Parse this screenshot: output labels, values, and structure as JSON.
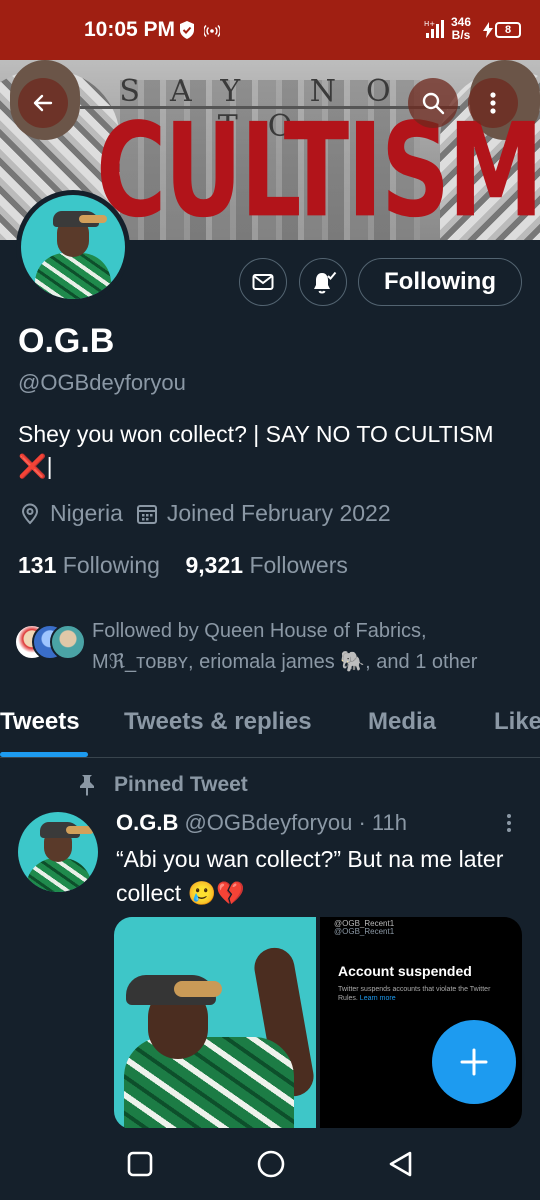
{
  "status_bar": {
    "time": "10:05 PM",
    "network_speed_value": "346",
    "network_speed_unit": "B/s",
    "battery": "8"
  },
  "header": {
    "banner_text_top": "SAY NO TO",
    "banner_text_main": "CULTISM",
    "back_icon": "arrow-left-icon",
    "search_icon": "search-icon",
    "more_icon": "more-vertical-icon"
  },
  "profile": {
    "display_name": "O.G.B",
    "handle": "@OGBdeyforyou",
    "bio": "Shey you won collect? | SAY NO TO CULTISM ❌|",
    "location": "Nigeria",
    "joined": "Joined February 2022",
    "following_count": "131",
    "following_label": "Following",
    "followers_count": "9,321",
    "followers_label": "Followers",
    "followed_by": "Followed by Queen House of Fabrics, Mℜ_ᴛᴏʙʙʏ, eriomala james 🐘, and 1 other",
    "follow_button_label": "Following"
  },
  "tabs": [
    {
      "label": "Tweets",
      "active": true
    },
    {
      "label": "Tweets & replies",
      "active": false
    },
    {
      "label": "Media",
      "active": false
    },
    {
      "label": "Likes",
      "active": false
    }
  ],
  "tweet": {
    "pinned_label": "Pinned Tweet",
    "author_name": "O.G.B",
    "author_handle": "@OGBdeyforyou",
    "time": "· 11h",
    "text": "“Abi you wan collect?” But na me later collect 🥲💔",
    "media_right": {
      "top_text": "@OGB_Recent1",
      "handle": "@OGB_Recent1",
      "title": "Account suspended",
      "description": "Twitter suspends accounts that violate the Twitter Rules.",
      "link": "Learn more"
    }
  },
  "colors": {
    "background": "#15202b",
    "status_bar": "#a01f12",
    "accent": "#1d9bf0",
    "secondary_text": "#8b98a5",
    "banner_red": "#b2141a"
  }
}
